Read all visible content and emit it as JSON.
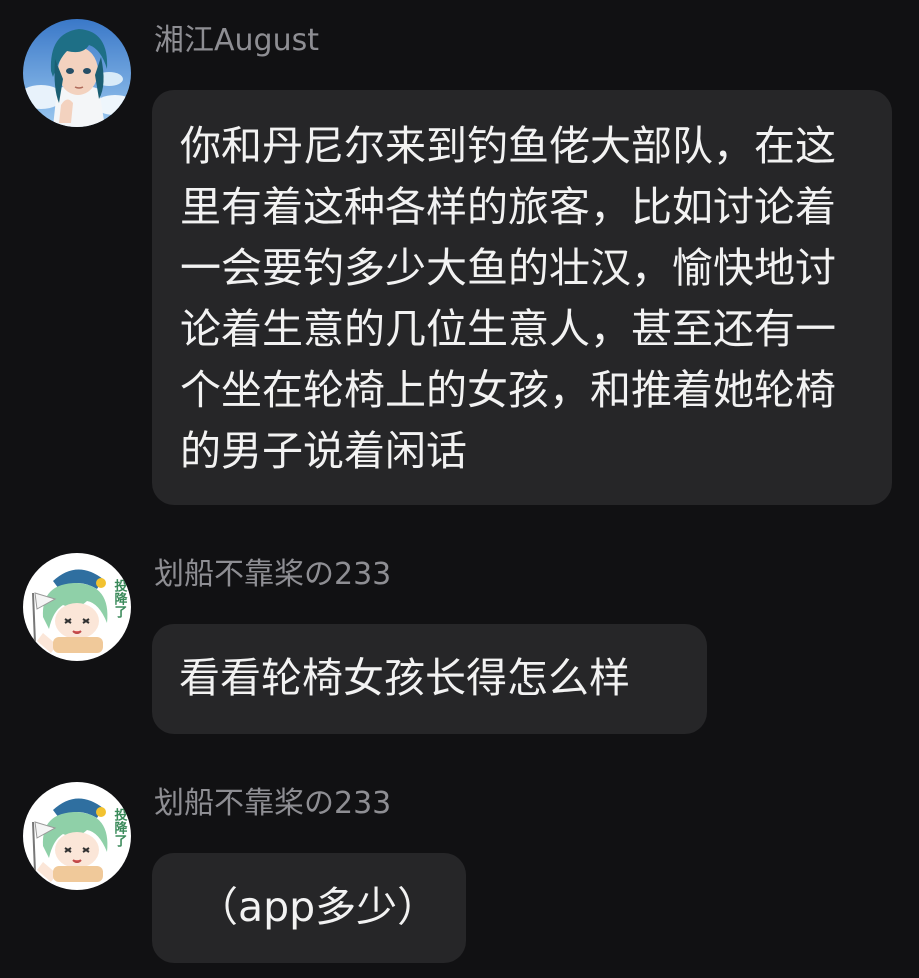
{
  "messages": [
    {
      "sender": "湘江August",
      "avatar_icon": "anime-boy-avatar-icon",
      "text": "你和丹尼尔来到钓鱼佬大部队，在这里有着这种各样的旅客，比如讨论着一会要钓多少大鱼的壮汉，愉快地讨论着生意的几位生意人，甚至还有一个坐在轮椅上的女孩，和推着她轮椅的男子说着闲话"
    },
    {
      "sender": "划船不靠桨の233",
      "avatar_icon": "anime-girl-surrender-sticker-icon",
      "avatar_sign": "投降了",
      "text": "看看轮椅女孩长得怎么样"
    },
    {
      "sender": "划船不靠桨の233",
      "avatar_icon": "anime-girl-surrender-sticker-icon",
      "avatar_sign": "投降了",
      "text": "（app多少）"
    }
  ],
  "colors": {
    "background": "#111113",
    "bubble": "#262628",
    "sender_text": "#8e8e93",
    "message_text": "#f2f2f2"
  }
}
